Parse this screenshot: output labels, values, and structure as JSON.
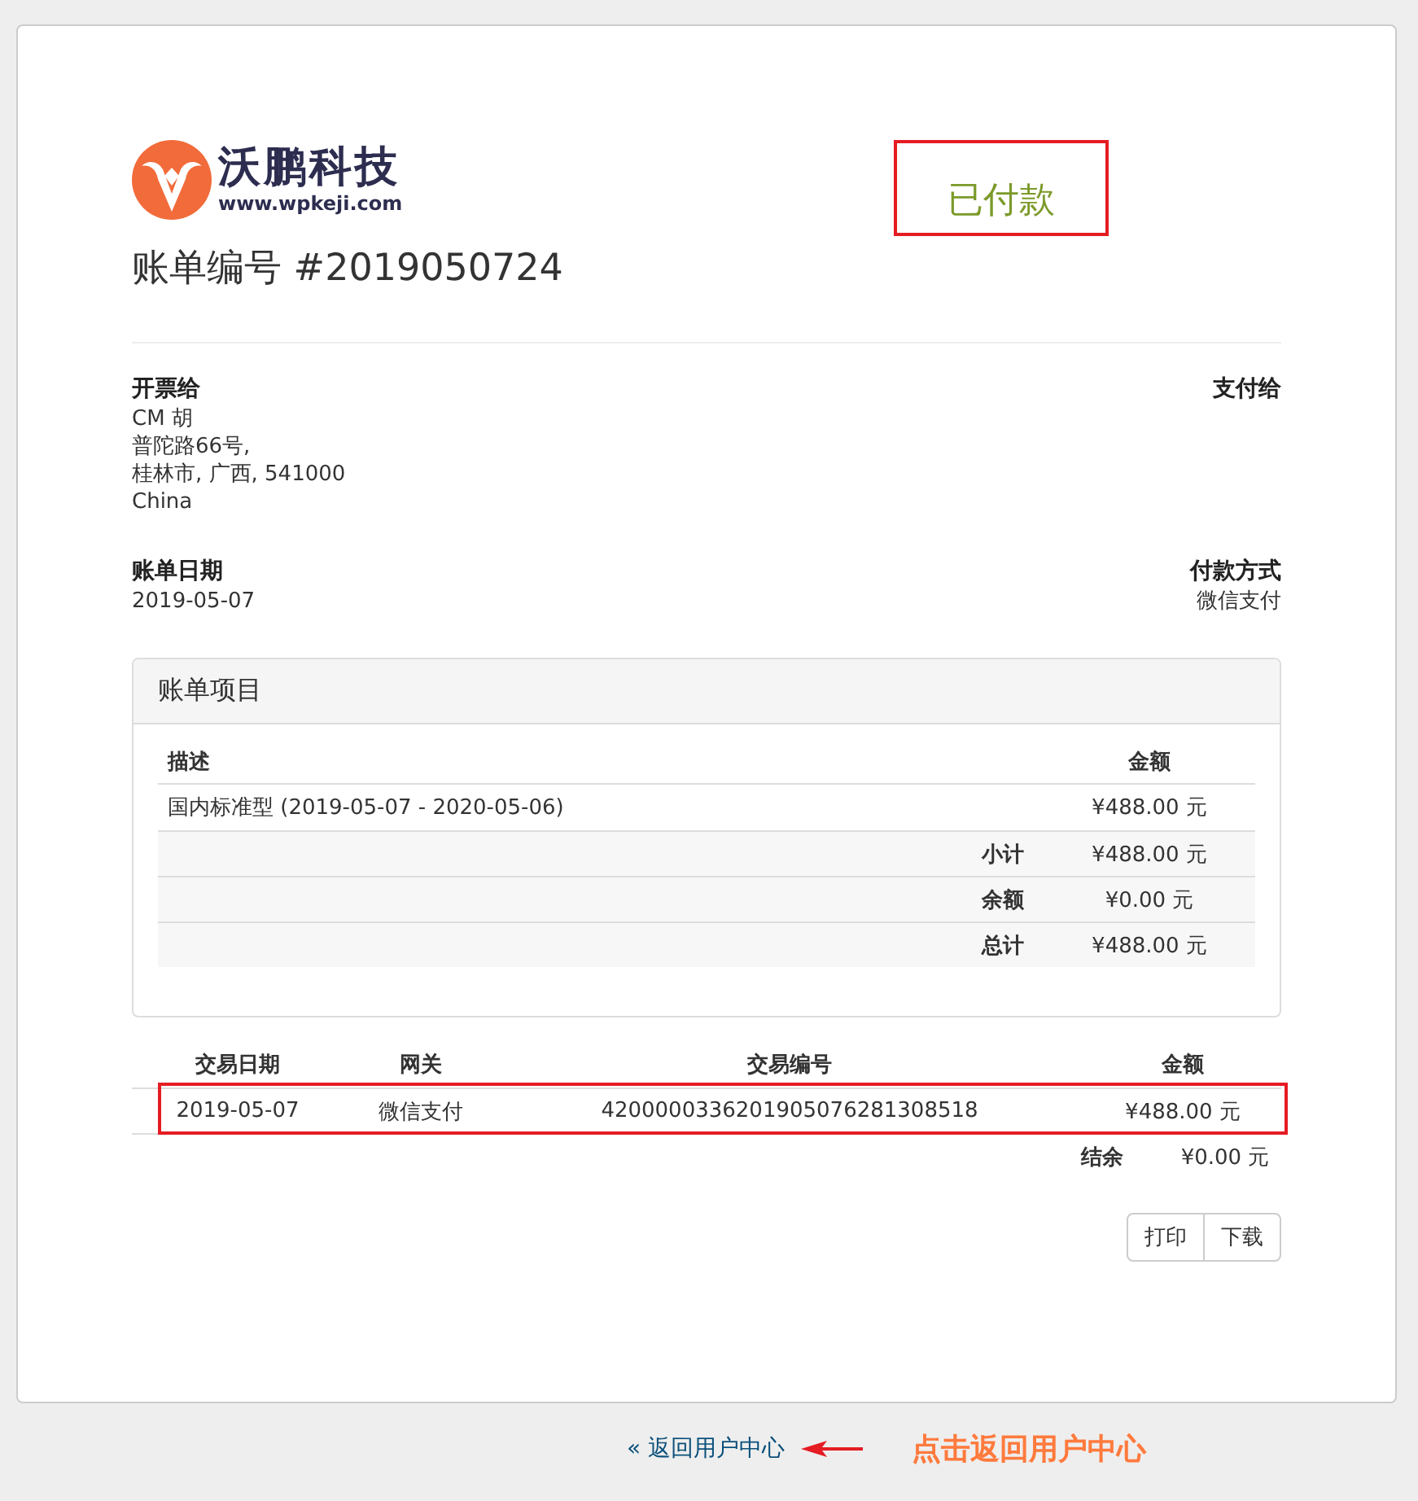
{
  "logo": {
    "name": "沃鹏科技",
    "url": "www.wpkeji.com"
  },
  "status": {
    "label": "已付款",
    "outlined": true
  },
  "title": "账单编号 #2019050724",
  "billed_to": {
    "heading": "开票给",
    "lines": [
      "CM 胡",
      "普陀路66号,",
      "桂林市, 广西, 541000",
      "China"
    ]
  },
  "pay_to": {
    "heading": "支付给"
  },
  "invoice_date": {
    "heading": "账单日期",
    "value": "2019-05-07"
  },
  "payment_method": {
    "heading": "付款方式",
    "value": "微信支付"
  },
  "items_panel": {
    "title": "账单项目",
    "columns": [
      "描述",
      "金额"
    ],
    "items": [
      {
        "description": "国内标准型 (2019-05-07 - 2020-05-06)",
        "amount": "¥488.00 元"
      }
    ],
    "totals": [
      {
        "label": "小计",
        "amount": "¥488.00 元"
      },
      {
        "label": "余额",
        "amount": "¥0.00 元"
      },
      {
        "label": "总计",
        "amount": "¥488.00 元"
      }
    ]
  },
  "transactions": {
    "columns": [
      "交易日期",
      "网关",
      "交易编号",
      "金额"
    ],
    "rows": [
      {
        "date": "2019-05-07",
        "gateway": "微信支付",
        "transaction_id": "4200000336201905076281308518",
        "amount": "¥488.00 元",
        "highlighted": true
      }
    ],
    "balance": {
      "label": "结余",
      "amount": "¥0.00 元"
    }
  },
  "buttons": [
    "打印",
    "下载"
  ],
  "footer": {
    "back_link": "« 返回用户中心",
    "annotation": "点击返回用户中心"
  }
}
